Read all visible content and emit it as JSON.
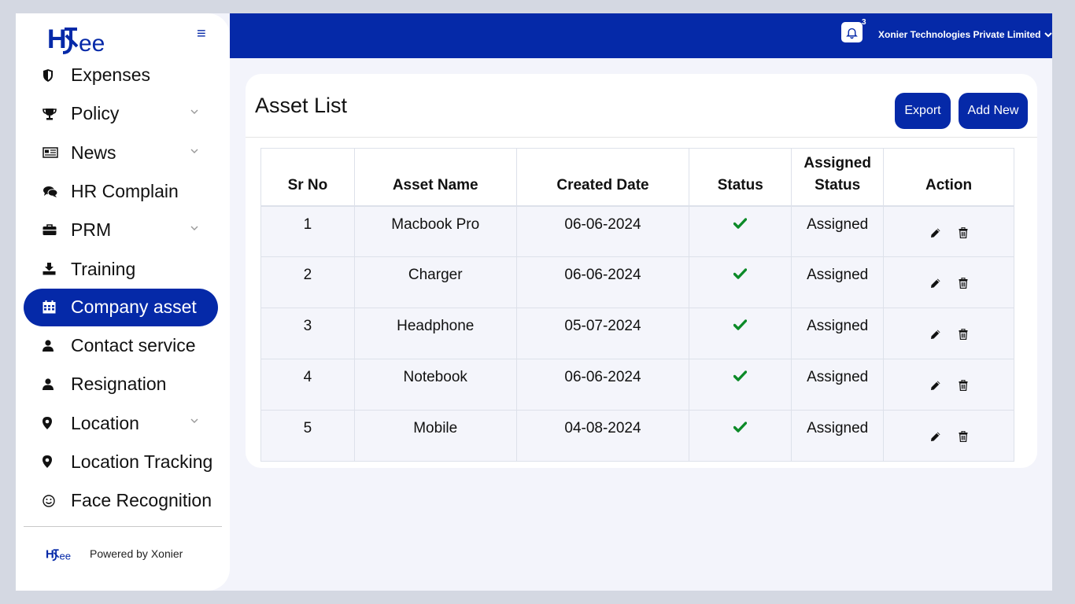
{
  "app": {
    "logo_text": "HRJee",
    "company_name": "Xonier Technologies Private Limited",
    "notification_count": "3",
    "powered_by": "Powered by Xonier"
  },
  "colors": {
    "brand": "#0529a8",
    "status_ok": "#0c8a28"
  },
  "sidebar": {
    "items": [
      {
        "label": "Expenses",
        "icon": "shield-icon",
        "chevron": false
      },
      {
        "label": "Policy",
        "icon": "trophy-icon",
        "chevron": true
      },
      {
        "label": "News",
        "icon": "newspaper-icon",
        "chevron": true
      },
      {
        "label": "HR Complain",
        "icon": "chat-bubbles-icon",
        "chevron": false
      },
      {
        "label": "PRM",
        "icon": "briefcase-icon",
        "chevron": true
      },
      {
        "label": "Training",
        "icon": "download-icon",
        "chevron": false
      },
      {
        "label": "Company asset",
        "icon": "calendar-icon",
        "chevron": false,
        "active": true
      },
      {
        "label": "Contact service",
        "icon": "user-icon",
        "chevron": false
      },
      {
        "label": "Resignation",
        "icon": "user-icon",
        "chevron": false
      },
      {
        "label": "Location",
        "icon": "map-pin-icon",
        "chevron": true
      },
      {
        "label": "Location Tracking",
        "icon": "map-pin-icon",
        "chevron": false
      },
      {
        "label": "Face Recognition",
        "icon": "smiley-icon",
        "chevron": false
      }
    ]
  },
  "main": {
    "title": "Asset List",
    "export_label": "Export",
    "add_new_label": "Add New",
    "table": {
      "headers": [
        "Sr No",
        "Asset Name",
        "Created Date",
        "Status",
        "Assigned Status",
        "Action"
      ],
      "rows": [
        {
          "sr": "1",
          "name": "Macbook Pro",
          "date": "06-06-2024",
          "status": "check-icon",
          "assigned": "Assigned"
        },
        {
          "sr": "2",
          "name": "Charger",
          "date": "06-06-2024",
          "status": "check-icon",
          "assigned": "Assigned"
        },
        {
          "sr": "3",
          "name": "Headphone",
          "date": "05-07-2024",
          "status": "check-icon",
          "assigned": "Assigned"
        },
        {
          "sr": "4",
          "name": "Notebook",
          "date": "06-06-2024",
          "status": "check-icon",
          "assigned": "Assigned"
        },
        {
          "sr": "5",
          "name": "Mobile",
          "date": "04-08-2024",
          "status": "check-icon",
          "assigned": "Assigned"
        }
      ]
    }
  }
}
